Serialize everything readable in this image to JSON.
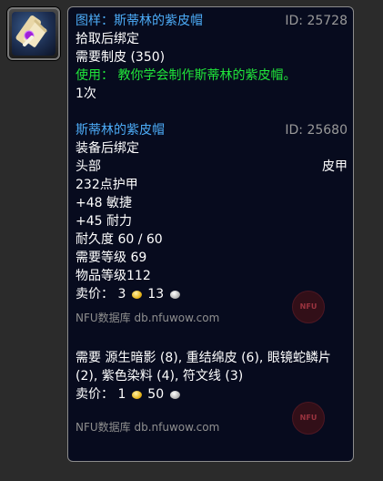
{
  "recipe": {
    "title": "图样：斯蒂林的紫皮帽",
    "id_label": "ID: 25728",
    "bind": "拾取后绑定",
    "requires": "需要制皮 (350)",
    "use_text": "使用： 教你学会制作斯蒂林的紫皮帽。",
    "charges": "1次"
  },
  "item": {
    "name": "斯蒂林的紫皮帽",
    "id_label": "ID: 25680",
    "bind": "装备后绑定",
    "slot": "头部",
    "type": "皮甲",
    "armor": "232点护甲",
    "stat1": "+48 敏捷",
    "stat2": "+45 耐力",
    "durability": "耐久度 60 / 60",
    "req_level": "需要等级 69",
    "item_level": "物品等级112",
    "sell_label": "卖价：",
    "sell_gold": "3",
    "sell_silver": "13"
  },
  "source": {
    "label": "NFU数据库 db.nfuwow.com",
    "watermark": "NFU"
  },
  "reagents": {
    "text": "需要 源生暗影 (8), 重结绵皮 (6), 眼镜蛇鳞片 (2), 紫色染料 (4), 符文线 (3)",
    "sell_label": "卖价：",
    "sell_gold": "1",
    "sell_silver": "50"
  },
  "colors": {
    "title_blue": "#4cabf6",
    "use_green": "#20e63a",
    "id_gray": "#999999",
    "background": "#070b1e"
  },
  "icons": {
    "item": "recipe-scroll-icon",
    "gold": "gold-coin-icon",
    "silver": "silver-coin-icon",
    "watermark": "nfu-logo-icon"
  }
}
